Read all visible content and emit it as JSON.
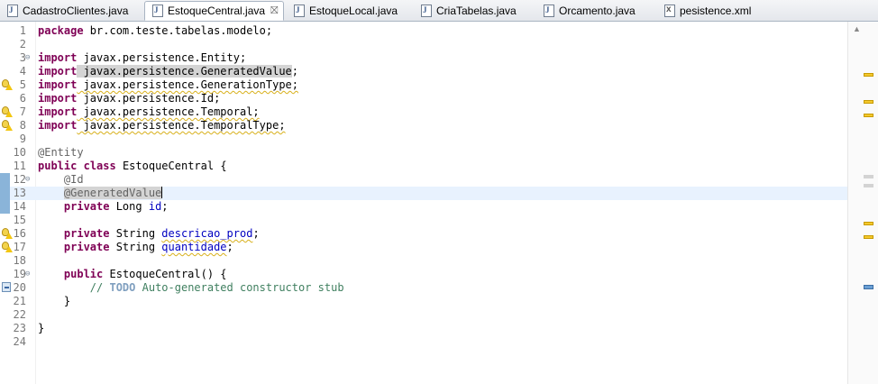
{
  "tabs": [
    {
      "label": "CadastroClientes.java",
      "icon": "java-file-icon",
      "active": false
    },
    {
      "label": "EstoqueCentral.java",
      "icon": "java-file-icon",
      "active": true,
      "close": "⛝"
    },
    {
      "label": "EstoqueLocal.java",
      "icon": "java-file-icon",
      "active": false
    },
    {
      "label": "CriaTabelas.java",
      "icon": "java-file-icon",
      "active": false
    },
    {
      "label": "Orcamento.java",
      "icon": "java-file-icon",
      "active": false
    },
    {
      "label": "pesistence.xml",
      "icon": "xml-file-icon",
      "active": false
    }
  ],
  "code": {
    "line_numbers": [
      "1",
      "2",
      "3",
      "4",
      "5",
      "6",
      "7",
      "8",
      "9",
      "10",
      "11",
      "12",
      "13",
      "14",
      "15",
      "16",
      "17",
      "18",
      "19",
      "20",
      "21",
      "22",
      "23",
      "24"
    ],
    "current_line": 13,
    "lines": {
      "l1": {
        "kw": "package",
        "rest": " br.com.teste.tabelas.modelo;"
      },
      "l3": {
        "kw": "import",
        "rest": " javax.persistence.Entity;"
      },
      "l4": {
        "kw": "import",
        "rest": " javax.persistence.GeneratedValue",
        "tail": ";"
      },
      "l5": {
        "kw": "import",
        "rest": " javax.persistence.GenerationType;"
      },
      "l6": {
        "kw": "import",
        "rest": " javax.persistence.Id;"
      },
      "l7": {
        "kw": "import",
        "rest": " javax.persistence.Temporal;"
      },
      "l8": {
        "kw": "import",
        "rest": " javax.persistence.TemporalType;"
      },
      "l10": {
        "ann": "@Entity"
      },
      "l11": {
        "kw1": "public",
        "kw2": "class",
        "rest": " EstoqueCentral {"
      },
      "l12": {
        "ann": "@Id"
      },
      "l13": {
        "ann": "@GeneratedValue"
      },
      "l14": {
        "kw": "private",
        "type": " Long ",
        "field": "id",
        "tail": ";"
      },
      "l16": {
        "kw": "private",
        "type": " String ",
        "field": "descricao_prod",
        "tail": ";"
      },
      "l17": {
        "kw": "private",
        "type": " String ",
        "field": "quantidade",
        "tail": ";"
      },
      "l19": {
        "kw": "public",
        "rest": " EstoqueCentral() {"
      },
      "l20": {
        "slashes": "// ",
        "todo": "TODO",
        "comment": " Auto-generated constructor stub"
      },
      "l21": {
        "rest": "}"
      },
      "l23": {
        "rest": "}"
      }
    },
    "gutter_markers": {
      "warning_lines": [
        5,
        7,
        8,
        16,
        17
      ],
      "occurrence_lines": [
        12,
        13,
        14
      ],
      "task_lines": [
        20
      ],
      "fold_lines": [
        3,
        12,
        19
      ]
    }
  },
  "colors": {
    "keyword": "#7f0055",
    "annotation": "#646464",
    "field": "#0000c0",
    "comment": "#3f7f5f",
    "todo": "#7f9fbf",
    "current_line": "#e8f2fe"
  }
}
